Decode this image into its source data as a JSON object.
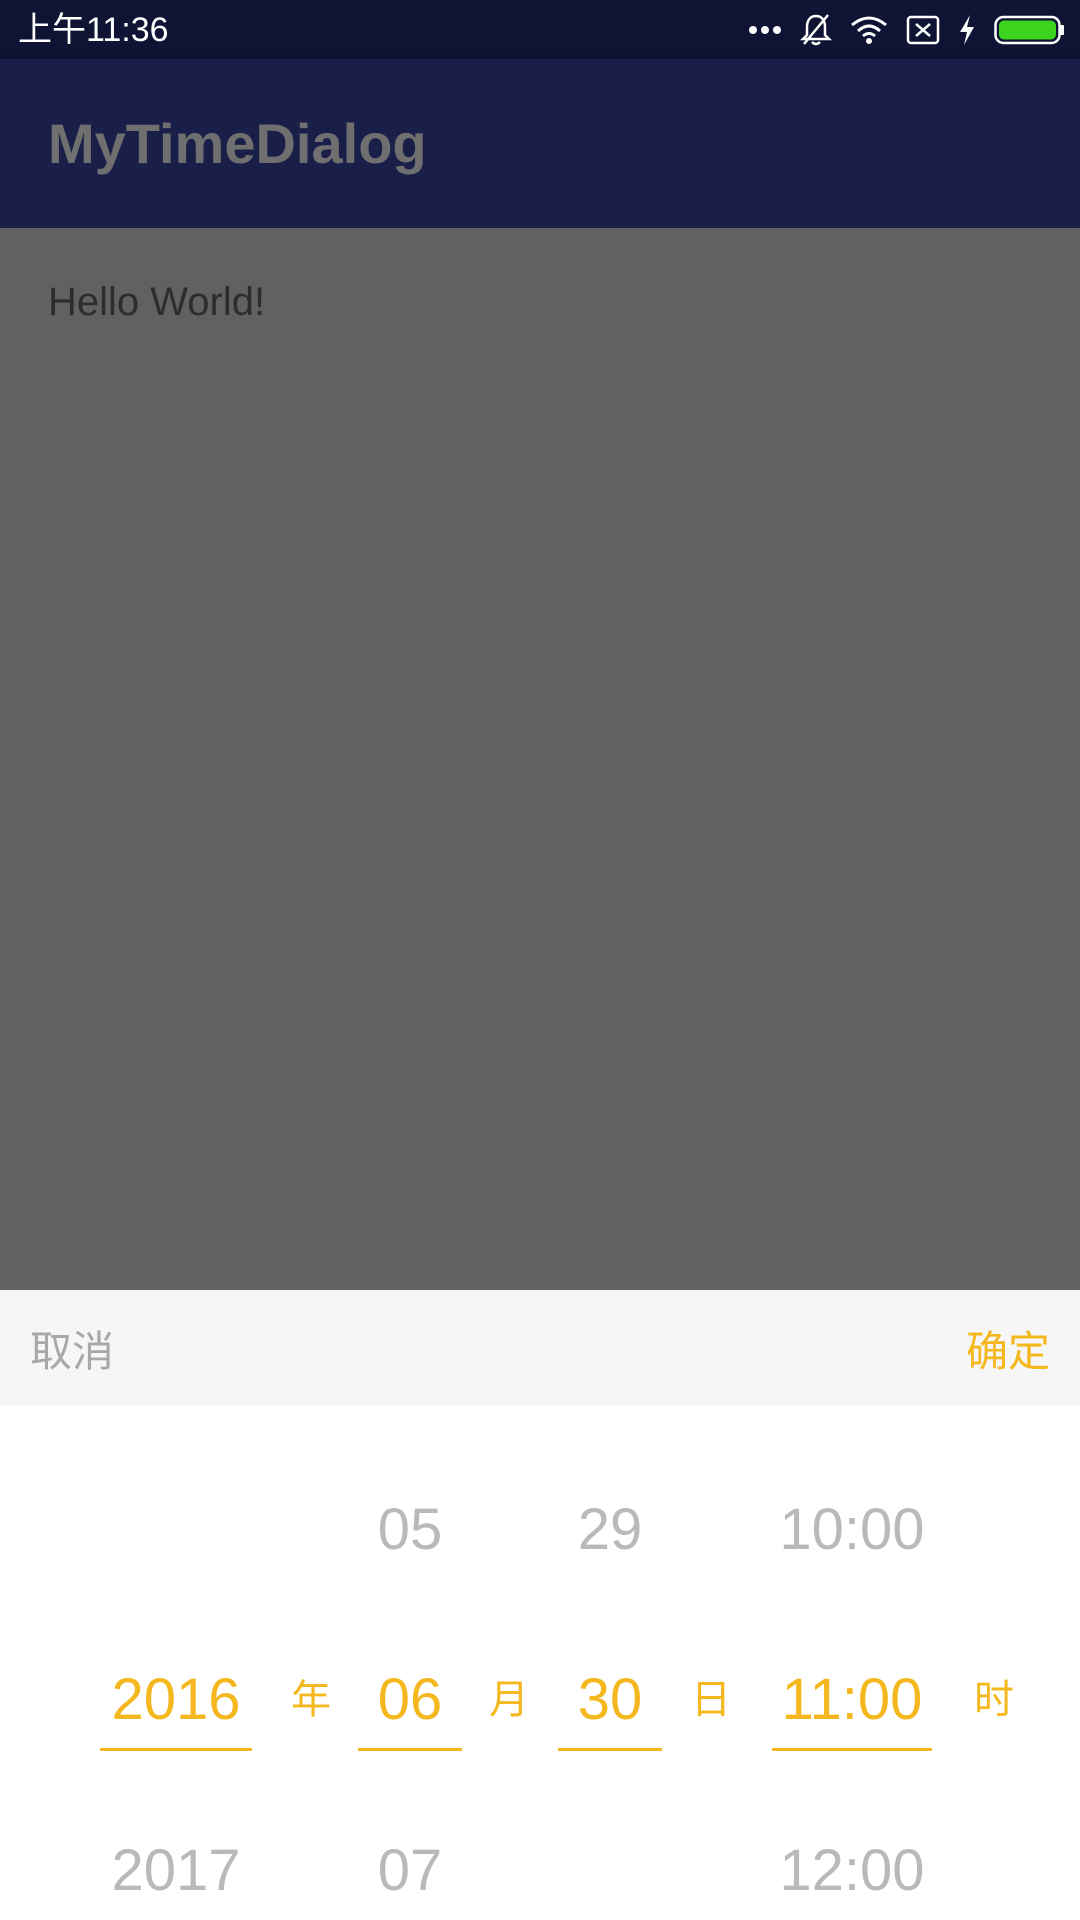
{
  "status_bar": {
    "time": "上午11:36",
    "icons": [
      "more-dots-icon",
      "notifications-off-icon",
      "wifi-icon",
      "sim-x-icon",
      "charging-icon",
      "battery-icon"
    ],
    "battery_color": "#3cd21d"
  },
  "app_bar": {
    "title": "MyTimeDialog",
    "color": "#1a1f4a"
  },
  "content": {
    "hello_text": "Hello World!"
  },
  "dialog": {
    "cancel_label": "取消",
    "confirm_label": "确定",
    "accent_color": "#f4b81e",
    "columns": {
      "year": {
        "above": "",
        "selected": "2016",
        "below": "2017",
        "unit": "年"
      },
      "month": {
        "above": "05",
        "selected": "06",
        "below": "07",
        "unit": "月"
      },
      "day": {
        "above": "29",
        "selected": "30",
        "below": "",
        "unit": "日"
      },
      "hour": {
        "above": "10:00",
        "selected": "11:00",
        "below": "12:00",
        "unit": "时"
      }
    }
  }
}
